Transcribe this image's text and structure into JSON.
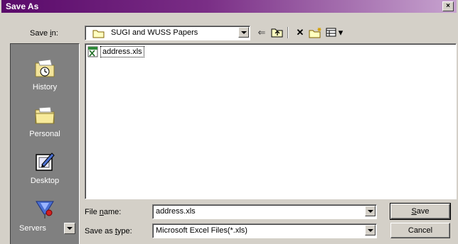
{
  "window": {
    "title": "Save As",
    "close_glyph": "×"
  },
  "save_in": {
    "label_pre": "Save ",
    "label_acc": "i",
    "label_post": "n:",
    "folder": "SUGI and WUSS Papers"
  },
  "toolbar": {
    "back_glyph": "⇐",
    "delete_glyph": "✕",
    "views_arrow_glyph": "▾",
    "icons": [
      "back-icon",
      "up-folder-icon",
      "delete-icon",
      "new-folder-icon",
      "views-icon"
    ]
  },
  "places": [
    {
      "label": "History",
      "icon": "history-icon"
    },
    {
      "label": "Personal",
      "icon": "personal-folder-icon"
    },
    {
      "label": "Desktop",
      "icon": "desktop-icon"
    },
    {
      "label": "Servers",
      "icon": "servers-icon"
    }
  ],
  "files": [
    {
      "name": "address.xls",
      "icon": "excel-file-icon"
    }
  ],
  "file_name": {
    "label_pre": "File ",
    "label_acc": "n",
    "label_post": "ame:",
    "value": "address.xls"
  },
  "save_as_type": {
    "label_pre": "Save as ",
    "label_acc": "t",
    "label_post": "ype:",
    "value": "Microsoft Excel Files(*.xls)"
  },
  "buttons": {
    "save_acc": "S",
    "save_rest": "ave",
    "cancel": "Cancel"
  },
  "colors": {
    "title_gradient_start": "#5a0a6a",
    "title_gradient_end": "#c7a3cf",
    "face": "#d4d0c8",
    "places_bg": "#808080"
  }
}
